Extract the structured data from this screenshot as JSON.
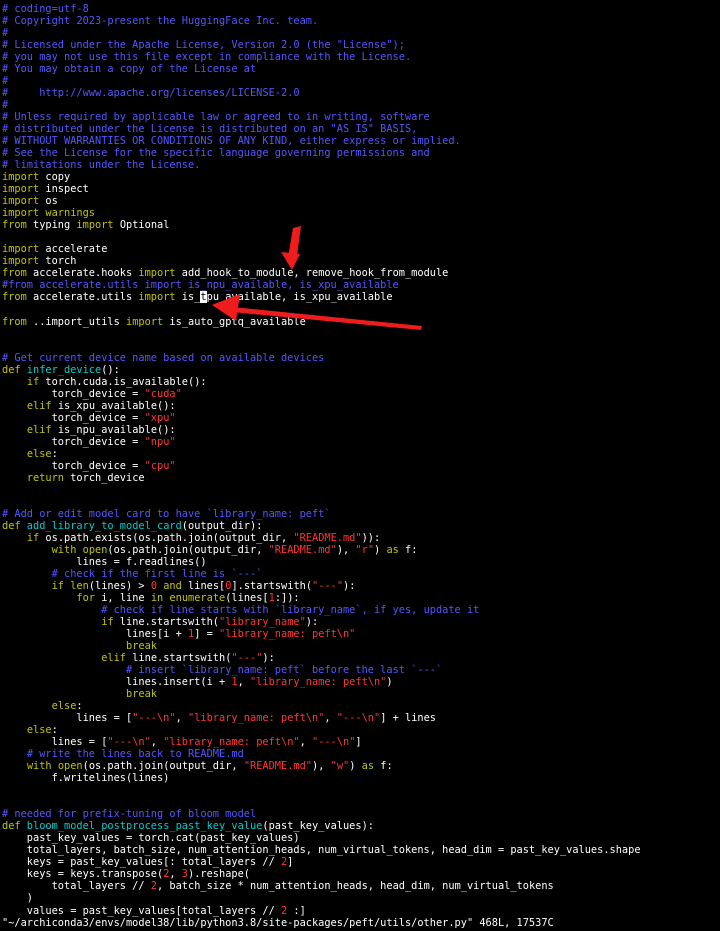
{
  "colors": {
    "background": "#000000",
    "comment": "#5555ff",
    "keyword": "#c4c400",
    "string": "#ff3535",
    "function": "#00cdcd",
    "plain": "#ffffff",
    "arrow": "#ee1c1c"
  },
  "editor": {
    "lines": [
      [
        [
          "c",
          "# coding=utf-8"
        ]
      ],
      [
        [
          "c",
          "# Copyright 2023-present the HuggingFace Inc. team."
        ]
      ],
      [
        [
          "c",
          "#"
        ]
      ],
      [
        [
          "c",
          "# Licensed under the Apache License, Version 2.0 (the \"License\");"
        ]
      ],
      [
        [
          "c",
          "# you may not use this file except in compliance with the License."
        ]
      ],
      [
        [
          "c",
          "# You may obtain a copy of the License at"
        ]
      ],
      [
        [
          "c",
          "#"
        ]
      ],
      [
        [
          "c",
          "#     http://www.apache.org/licenses/LICENSE-2.0"
        ]
      ],
      [
        [
          "c",
          "#"
        ]
      ],
      [
        [
          "c",
          "# Unless required by applicable law or agreed to in writing, software"
        ]
      ],
      [
        [
          "c",
          "# distributed under the License is distributed on an \"AS IS\" BASIS,"
        ]
      ],
      [
        [
          "c",
          "# WITHOUT WARRANTIES OR CONDITIONS OF ANY KIND, either express or implied."
        ]
      ],
      [
        [
          "c",
          "# See the License for the specific language governing permissions and"
        ]
      ],
      [
        [
          "c",
          "# limitations under the License."
        ]
      ],
      [
        [
          "k",
          "import"
        ],
        [
          "p",
          " copy"
        ]
      ],
      [
        [
          "k",
          "import"
        ],
        [
          "p",
          " inspect"
        ]
      ],
      [
        [
          "k",
          "import"
        ],
        [
          "p",
          " os"
        ]
      ],
      [
        [
          "k",
          "import"
        ],
        [
          "k",
          " warnings"
        ]
      ],
      [
        [
          "k",
          "from"
        ],
        [
          "p",
          " typing "
        ],
        [
          "k",
          "import"
        ],
        [
          "p",
          " Optional"
        ]
      ],
      [],
      [
        [
          "k",
          "import"
        ],
        [
          "p",
          " accelerate"
        ]
      ],
      [
        [
          "k",
          "import"
        ],
        [
          "p",
          " torch"
        ]
      ],
      [
        [
          "k",
          "from"
        ],
        [
          "p",
          " accelerate.hooks "
        ],
        [
          "k",
          "import"
        ],
        [
          "p",
          " add_hook_to_module, remove_hook_from_module"
        ]
      ],
      [
        [
          "c",
          "#from accelerate.utils import is_npu_available, is_xpu_available"
        ]
      ],
      [
        [
          "k",
          "from"
        ],
        [
          "p",
          " accelerate.utils "
        ],
        [
          "k",
          "import"
        ],
        [
          "p",
          " is_"
        ],
        [
          "u",
          "t"
        ],
        [
          "p",
          "pu_available, is_xpu_available"
        ]
      ],
      [],
      [
        [
          "k",
          "from"
        ],
        [
          "p",
          " ..import_utils "
        ],
        [
          "k",
          "import"
        ],
        [
          "p",
          " is_auto_gptq_available"
        ]
      ],
      [],
      [],
      [
        [
          "c",
          "# Get current device name based on available devices"
        ]
      ],
      [
        [
          "k",
          "def"
        ],
        [
          "f",
          " infer_device"
        ],
        [
          "p",
          "():"
        ]
      ],
      [
        [
          "p",
          "    "
        ],
        [
          "k",
          "if"
        ],
        [
          "p",
          " torch.cuda.is_available():"
        ]
      ],
      [
        [
          "p",
          "        torch_device = "
        ],
        [
          "s",
          "\"cuda\""
        ]
      ],
      [
        [
          "p",
          "    "
        ],
        [
          "k",
          "elif"
        ],
        [
          "p",
          " is_xpu_available():"
        ]
      ],
      [
        [
          "p",
          "        torch_device = "
        ],
        [
          "s",
          "\"xpu\""
        ]
      ],
      [
        [
          "p",
          "    "
        ],
        [
          "k",
          "elif"
        ],
        [
          "p",
          " is_npu_available():"
        ]
      ],
      [
        [
          "p",
          "        torch_device = "
        ],
        [
          "s",
          "\"npu\""
        ]
      ],
      [
        [
          "p",
          "    "
        ],
        [
          "k",
          "else"
        ],
        [
          "p",
          ":"
        ]
      ],
      [
        [
          "p",
          "        torch_device = "
        ],
        [
          "s",
          "\"cpu\""
        ]
      ],
      [
        [
          "p",
          "    "
        ],
        [
          "k",
          "return"
        ],
        [
          "p",
          " torch_device"
        ]
      ],
      [],
      [],
      [
        [
          "c",
          "# Add or edit model card to have `library_name: peft`"
        ]
      ],
      [
        [
          "k",
          "def"
        ],
        [
          "f",
          " add_library_to_model_card"
        ],
        [
          "p",
          "(output_dir):"
        ]
      ],
      [
        [
          "p",
          "    "
        ],
        [
          "k",
          "if"
        ],
        [
          "p",
          " os.path.exists(os.path.join(output_dir, "
        ],
        [
          "s",
          "\"README.md\""
        ],
        [
          "p",
          "))"
        ],
        [
          "p",
          ":"
        ]
      ],
      [
        [
          "p",
          "        "
        ],
        [
          "k",
          "with"
        ],
        [
          "k",
          " open"
        ],
        [
          "p",
          "(os.path.join(output_dir, "
        ],
        [
          "s",
          "\"README.md\""
        ],
        [
          "p",
          "), "
        ],
        [
          "s",
          "\"r\""
        ],
        [
          "p",
          ") "
        ],
        [
          "k",
          "as"
        ],
        [
          "p",
          " f:"
        ]
      ],
      [
        [
          "p",
          "            lines = f.readlines()"
        ]
      ],
      [
        [
          "p",
          "        "
        ],
        [
          "c",
          "# check if the first line is `---`"
        ]
      ],
      [
        [
          "p",
          "        "
        ],
        [
          "k",
          "if"
        ],
        [
          "k",
          " len"
        ],
        [
          "p",
          "(lines) > "
        ],
        [
          "s",
          "0"
        ],
        [
          "k",
          " and"
        ],
        [
          "p",
          " lines["
        ],
        [
          "s",
          "0"
        ],
        [
          "p",
          "].startswith("
        ],
        [
          "s",
          "\"---\""
        ],
        [
          "p",
          "):"
        ]
      ],
      [
        [
          "p",
          "            "
        ],
        [
          "k",
          "for"
        ],
        [
          "p",
          " i, line "
        ],
        [
          "k",
          "in"
        ],
        [
          "k",
          " enumerate"
        ],
        [
          "p",
          "(lines["
        ],
        [
          "s",
          "1"
        ],
        [
          "p",
          ":]):"
        ]
      ],
      [
        [
          "p",
          "                "
        ],
        [
          "c",
          "# check if line starts with `library_name`, if yes, update it"
        ]
      ],
      [
        [
          "p",
          "                "
        ],
        [
          "k",
          "if"
        ],
        [
          "p",
          " line.startswith("
        ],
        [
          "s",
          "\"library_name\""
        ],
        [
          "p",
          "):"
        ]
      ],
      [
        [
          "p",
          "                    lines[i + "
        ],
        [
          "s",
          "1"
        ],
        [
          "p",
          "] = "
        ],
        [
          "s",
          "\"library_name: peft\\n\""
        ]
      ],
      [
        [
          "p",
          "                    "
        ],
        [
          "k",
          "break"
        ]
      ],
      [
        [
          "p",
          "                "
        ],
        [
          "k",
          "elif"
        ],
        [
          "p",
          " line.startswith("
        ],
        [
          "s",
          "\"---\""
        ],
        [
          "p",
          "):"
        ]
      ],
      [
        [
          "p",
          "                    "
        ],
        [
          "c",
          "# insert `library_name: peft` before the last `---`"
        ]
      ],
      [
        [
          "p",
          "                    lines.insert(i + "
        ],
        [
          "s",
          "1"
        ],
        [
          "p",
          ", "
        ],
        [
          "s",
          "\"library_name: peft\\n\""
        ],
        [
          "p",
          ")"
        ]
      ],
      [
        [
          "p",
          "                    "
        ],
        [
          "k",
          "break"
        ]
      ],
      [
        [
          "p",
          "        "
        ],
        [
          "k",
          "else"
        ],
        [
          "p",
          ":"
        ]
      ],
      [
        [
          "p",
          "            lines = ["
        ],
        [
          "s",
          "\"---\\n\""
        ],
        [
          "p",
          ", "
        ],
        [
          "s",
          "\"library_name: peft\\n\""
        ],
        [
          "p",
          ", "
        ],
        [
          "s",
          "\"---\\n\""
        ],
        [
          "p",
          "] + lines"
        ]
      ],
      [
        [
          "p",
          "    "
        ],
        [
          "k",
          "else"
        ],
        [
          "p",
          ":"
        ]
      ],
      [
        [
          "p",
          "        lines = ["
        ],
        [
          "s",
          "\"---\\n\""
        ],
        [
          "p",
          ", "
        ],
        [
          "s",
          "\"library_name: peft\\n\""
        ],
        [
          "p",
          ", "
        ],
        [
          "s",
          "\"---\\n\""
        ],
        [
          "p",
          "]"
        ]
      ],
      [
        [
          "p",
          "    "
        ],
        [
          "c",
          "# write the lines back to README.md"
        ]
      ],
      [
        [
          "p",
          "    "
        ],
        [
          "k",
          "with"
        ],
        [
          "k",
          " open"
        ],
        [
          "p",
          "(os.path.join(output_dir, "
        ],
        [
          "s",
          "\"README.md\""
        ],
        [
          "p",
          "), "
        ],
        [
          "s",
          "\"w\""
        ],
        [
          "p",
          ") "
        ],
        [
          "k",
          "as"
        ],
        [
          "p",
          " f:"
        ]
      ],
      [
        [
          "p",
          "        f.writelines(lines)"
        ]
      ],
      [],
      [],
      [
        [
          "c",
          "# needed for prefix-tuning of bloom model"
        ]
      ],
      [
        [
          "k",
          "def"
        ],
        [
          "f",
          " bloom_model_postprocess_past_key_value"
        ],
        [
          "p",
          "(past_key_values):"
        ]
      ],
      [
        [
          "p",
          "    past_key_values = torch.cat(past_key_values)"
        ]
      ],
      [
        [
          "p",
          "    total_layers, batch_size, num_attention_heads, num_virtual_tokens, head_dim = past_key_values.shape"
        ]
      ],
      [
        [
          "p",
          "    keys = past_key_values[: total_layers // "
        ],
        [
          "s",
          "2"
        ],
        [
          "p",
          "]"
        ]
      ],
      [
        [
          "p",
          "    keys = keys.transpose("
        ],
        [
          "s",
          "2"
        ],
        [
          "p",
          ", "
        ],
        [
          "s",
          "3"
        ],
        [
          "p",
          ").reshape("
        ]
      ],
      [
        [
          "p",
          "        total_layers // "
        ],
        [
          "s",
          "2"
        ],
        [
          "p",
          ", batch_size * num_attention_heads, head_dim, num_virtual_tokens"
        ]
      ],
      [
        [
          "p",
          "    )"
        ]
      ],
      [
        [
          "p",
          "    values = past_key_values[total_layers // "
        ],
        [
          "s",
          "2"
        ],
        [
          "p",
          " :]"
        ]
      ],
      [
        [
          "p",
          "\"~/archiconda3/envs/model38/lib/python3.8/site-packages/peft/utils/other.py\" 468L, 17537C"
        ]
      ]
    ]
  }
}
